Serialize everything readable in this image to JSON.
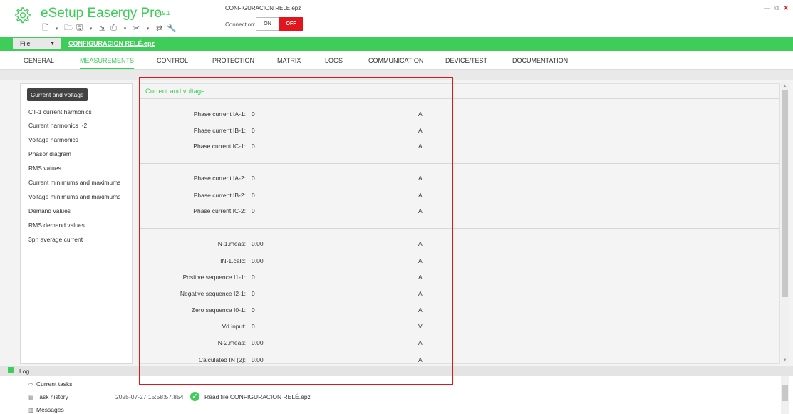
{
  "app": {
    "title": "eSetup Easergy Pro",
    "version": "v4.9.1",
    "file_title": "CONFIGURACION RELE.epz",
    "connection_label": "Connection:",
    "connection_on": "ON",
    "connection_off": "OFF",
    "brand_green": "#3dcd58",
    "alert_red": "#e2141c",
    "toolbar_icons": [
      "new-file-icon",
      "dropdown-icon",
      "open-folder-icon",
      "save-icon",
      "dropdown-icon",
      "export-icon",
      "print-icon",
      "dropdown-icon",
      "tools-icon",
      "dropdown-icon",
      "compare-icon",
      "wrench-icon"
    ]
  },
  "greenbar": {
    "file_menu": "File",
    "filename": "CONFIGURACION RELÉ.epz"
  },
  "tabs": [
    "GENERAL",
    "MEASUREMENTS",
    "CONTROL",
    "PROTECTION",
    "MATRIX",
    "LOGS",
    "COMMUNICATION",
    "DEVICE/TEST",
    "DOCUMENTATION"
  ],
  "active_tab": "MEASUREMENTS",
  "nav": {
    "items": [
      "Current and voltage",
      "CT-1 current harmonics",
      "Current harmonics I-2",
      "Voltage harmonics",
      "Phasor diagram",
      "RMS values",
      "Current minimums and maximums",
      "Voltage minimums and maximums",
      "Demand values",
      "RMS demand values",
      "3ph average current"
    ],
    "selected": "Current and voltage"
  },
  "content": {
    "title": "Current and voltage",
    "group1": [
      {
        "label": "Phase current IA-1:",
        "value": "0",
        "unit": "A"
      },
      {
        "label": "Phase current IB-1:",
        "value": "0",
        "unit": "A"
      },
      {
        "label": "Phase current IC-1:",
        "value": "0",
        "unit": "A"
      }
    ],
    "group2": [
      {
        "label": "Phase current IA-2:",
        "value": "0",
        "unit": "A"
      },
      {
        "label": "Phase current IB-2:",
        "value": "0",
        "unit": "A"
      },
      {
        "label": "Phase current IC-2:",
        "value": "0",
        "unit": "A"
      }
    ],
    "group3": [
      {
        "label": "IN-1.meas:",
        "value": "0.00",
        "unit": "A"
      },
      {
        "label": "IN-1.calc:",
        "value": "0.00",
        "unit": "A"
      },
      {
        "label": "Positive sequence I1-1:",
        "value": "0",
        "unit": "A"
      },
      {
        "label": "Negative sequence I2-1:",
        "value": "0",
        "unit": "A"
      },
      {
        "label": "Zero sequence I0-1:",
        "value": "0",
        "unit": "A"
      },
      {
        "label": "Vd input:",
        "value": "0",
        "unit": "V"
      },
      {
        "label": "IN-2.meas:",
        "value": "0.00",
        "unit": "A"
      },
      {
        "label": "Calculated IN (2):",
        "value": "0.00",
        "unit": "A"
      }
    ]
  },
  "log": {
    "title": "Log",
    "items": [
      "Current tasks",
      "Task history",
      "Messages"
    ],
    "entry_time": "2025-07-27 15:58:57.854",
    "entry_message": "Read file CONFIGURACION RELÉ.epz"
  }
}
